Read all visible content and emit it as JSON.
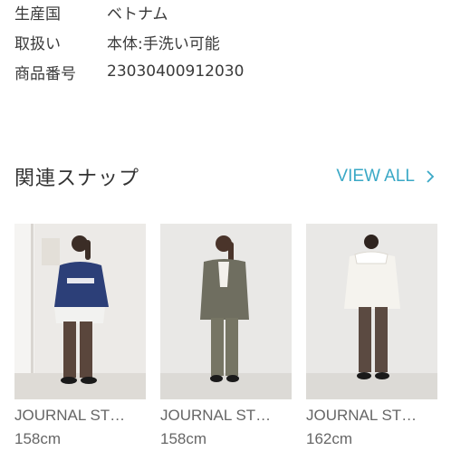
{
  "specs": [
    {
      "label": "生産国",
      "value": "ベトナム"
    },
    {
      "label": "取扱い",
      "value": "本体:手洗い可能"
    },
    {
      "label": "商品番号",
      "value": "23030400912030"
    }
  ],
  "related": {
    "title": "関連スナップ",
    "view_all_label": "VIEW ALL",
    "accent_color": "#3aa8c6",
    "cards": [
      {
        "title": "JOURNAL ST…",
        "height": "158cm"
      },
      {
        "title": "JOURNAL ST…",
        "height": "158cm"
      },
      {
        "title": "JOURNAL ST…",
        "height": "162cm"
      }
    ]
  }
}
